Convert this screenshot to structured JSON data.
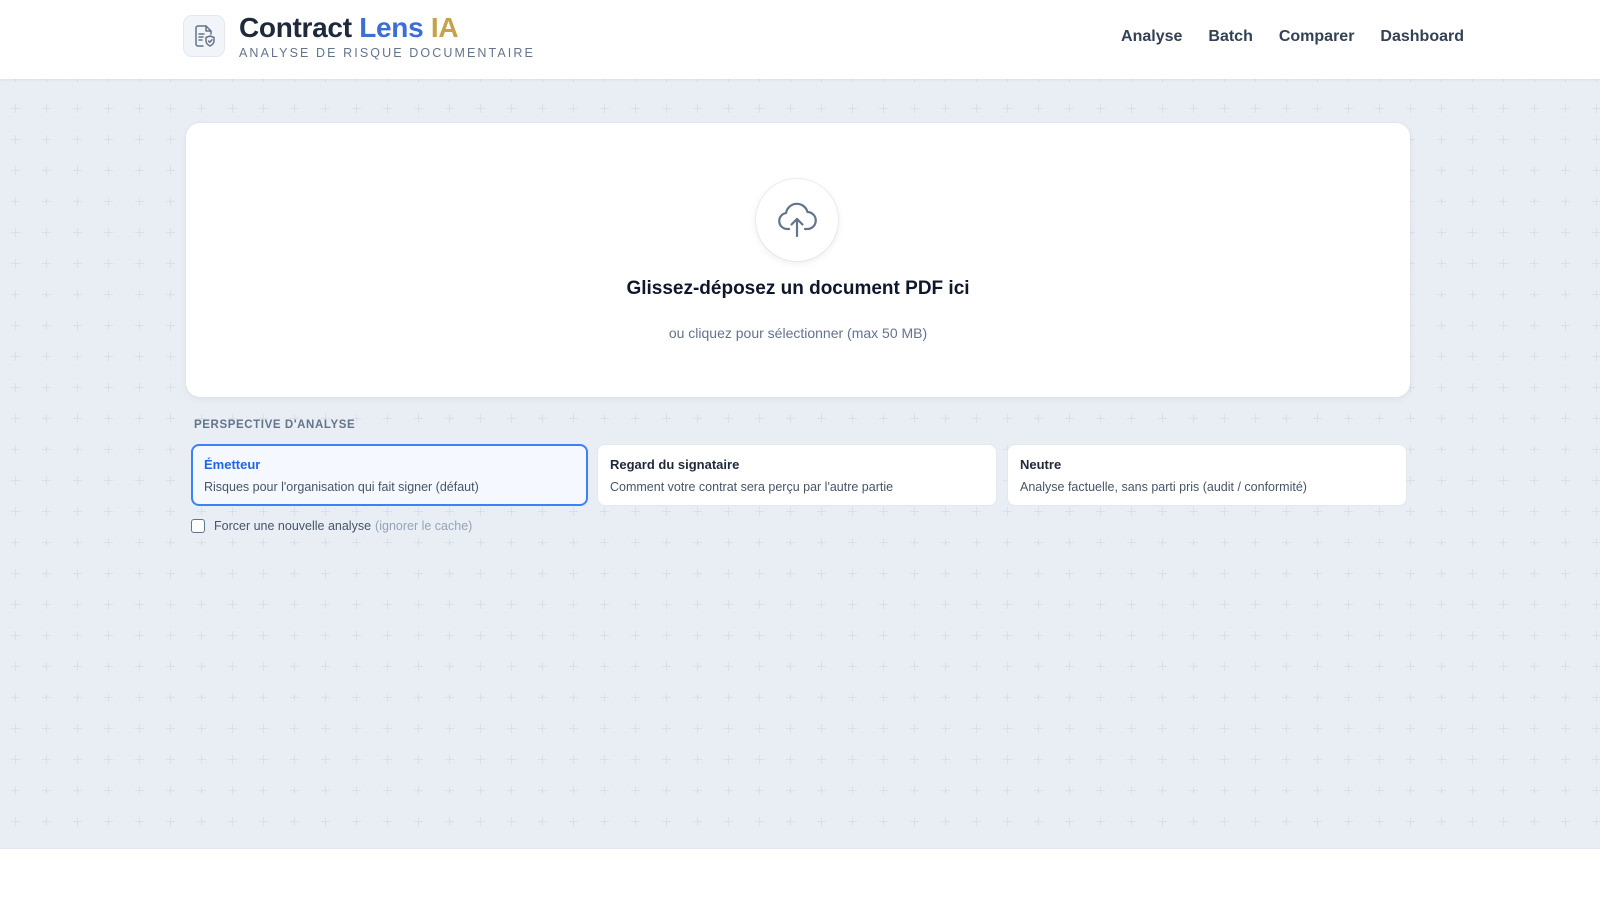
{
  "header": {
    "title_part1": "Contract",
    "title_part2": "Lens",
    "title_part3": "IA",
    "subtitle": "ANALYSE DE RISQUE DOCUMENTAIRE",
    "logo_icon": "document-shield-icon",
    "nav": [
      {
        "label": "Analyse"
      },
      {
        "label": "Batch"
      },
      {
        "label": "Comparer"
      },
      {
        "label": "Dashboard"
      }
    ]
  },
  "dropzone": {
    "icon": "cloud-upload-icon",
    "title": "Glissez-déposez un document PDF ici",
    "subtitle": "ou cliquez pour sélectionner (max 50 MB)"
  },
  "perspective": {
    "label": "PERSPECTIVE D'ANALYSE",
    "options": [
      {
        "title": "Émetteur",
        "description": "Risques pour l'organisation qui fait signer (défaut)",
        "selected": true
      },
      {
        "title": "Regard du signataire",
        "description": "Comment votre contrat sera perçu par l'autre partie",
        "selected": false
      },
      {
        "title": "Neutre",
        "description": "Analyse factuelle, sans parti pris (audit / conformité)",
        "selected": false
      }
    ]
  },
  "force_reanalysis": {
    "label": "Forcer une nouvelle analyse",
    "hint": "(ignorer le cache)",
    "checked": false
  },
  "colors": {
    "accent_blue": "#3b6fd4",
    "accent_gold": "#c6a24a",
    "selected_border": "#3b82f6"
  }
}
